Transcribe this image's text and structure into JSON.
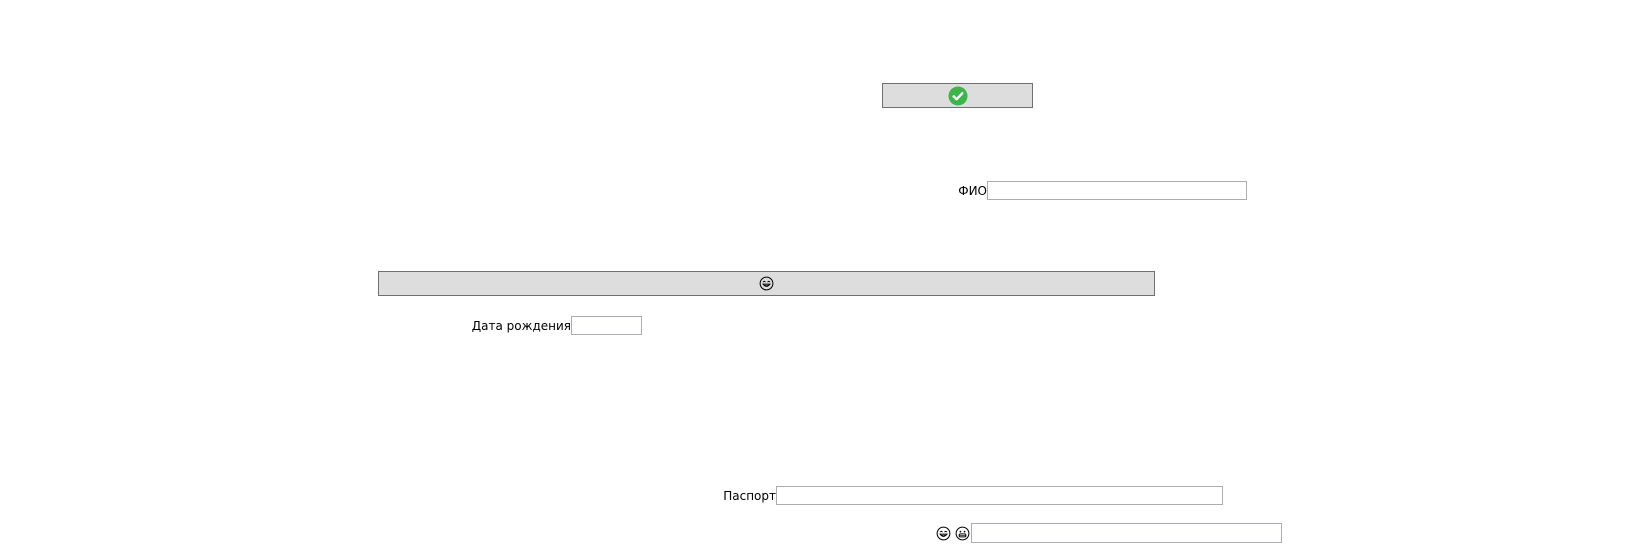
{
  "confirm_button": {
    "icon": "check-circle-icon",
    "accent": "#3cb54a"
  },
  "fio": {
    "label": "ФИО",
    "value": ""
  },
  "smile_button": {
    "icon": "laughing-face-icon"
  },
  "birth_date": {
    "label": "Дата рождения",
    "value": ""
  },
  "passport": {
    "label": "Паспорт",
    "value": ""
  },
  "emoji_field": {
    "icons": [
      "laughing-face-icon",
      "grinning-face-icon"
    ],
    "value": ""
  }
}
